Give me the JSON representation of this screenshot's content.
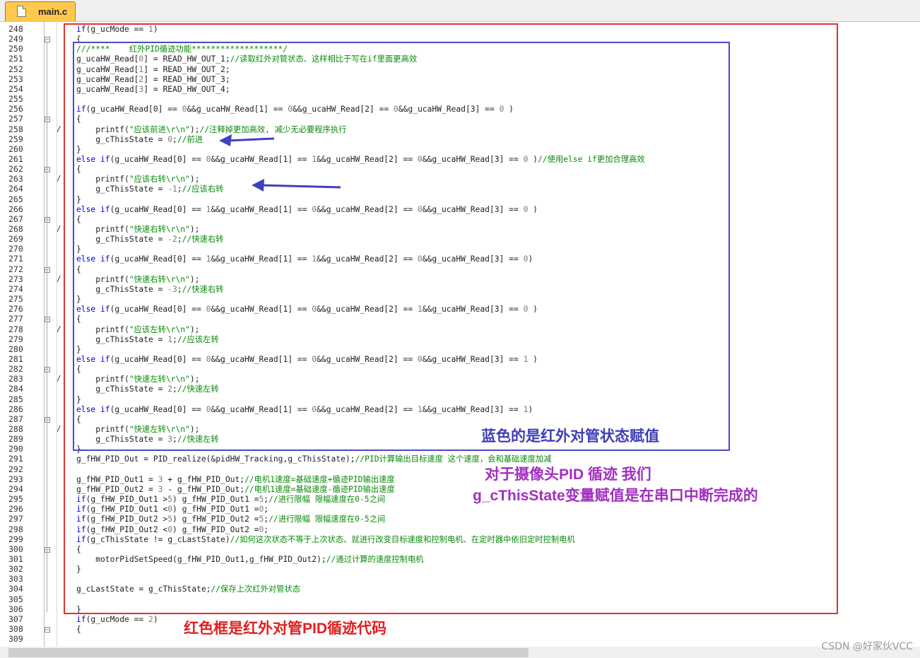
{
  "tab": {
    "filename": "main.c"
  },
  "line_numbers": [
    "248",
    "249",
    "250",
    "251",
    "252",
    "253",
    "254",
    "255",
    "256",
    "257",
    "258",
    "259",
    "260",
    "261",
    "262",
    "263",
    "264",
    "265",
    "266",
    "267",
    "268",
    "269",
    "270",
    "271",
    "272",
    "273",
    "274",
    "275",
    "276",
    "277",
    "278",
    "279",
    "280",
    "281",
    "282",
    "283",
    "284",
    "285",
    "286",
    "287",
    "288",
    "289",
    "290",
    "291",
    "292",
    "293",
    "294",
    "295",
    "296",
    "297",
    "298",
    "299",
    "300",
    "301",
    "302",
    "303",
    "304",
    "305",
    "306",
    "307",
    "308",
    "309"
  ],
  "fold_lines": [
    "249",
    "257",
    "262",
    "267",
    "272",
    "277",
    "282",
    "287",
    "300",
    "308"
  ],
  "comment_marks": [
    "258",
    "263",
    "268",
    "273",
    "278",
    "283",
    "288"
  ],
  "code_lines": [
    [
      [
        "kw",
        "if"
      ],
      [
        "t",
        "(g_ucMode == "
      ],
      [
        "num",
        "1"
      ],
      [
        "t",
        ")"
      ]
    ],
    [
      [
        "t",
        "{"
      ]
    ],
    [
      [
        "cmt",
        "///****    红外PID循迹功能*******************/"
      ]
    ],
    [
      [
        "t",
        "g_ucaHW_Read["
      ],
      [
        "num",
        "0"
      ],
      [
        "t",
        "] = READ_HW_OUT_1;"
      ],
      [
        "cmt",
        "//读取红外对管状态、这样相比于写在if里面更高效"
      ]
    ],
    [
      [
        "t",
        "g_ucaHW_Read["
      ],
      [
        "num",
        "1"
      ],
      [
        "t",
        "] = READ_HW_OUT_2;"
      ]
    ],
    [
      [
        "t",
        "g_ucaHW_Read["
      ],
      [
        "num",
        "2"
      ],
      [
        "t",
        "] = READ_HW_OUT_3;"
      ]
    ],
    [
      [
        "t",
        "g_ucaHW_Read["
      ],
      [
        "num",
        "3"
      ],
      [
        "t",
        "] = READ_HW_OUT_4;"
      ]
    ],
    [],
    [
      [
        "kw",
        "if"
      ],
      [
        "t",
        "(g_ucaHW_Read[0] == "
      ],
      [
        "num",
        "0"
      ],
      [
        "t",
        "&&g_ucaHW_Read[1] == "
      ],
      [
        "num",
        "0"
      ],
      [
        "t",
        "&&g_ucaHW_Read[2] == "
      ],
      [
        "num",
        "0"
      ],
      [
        "t",
        "&&g_ucaHW_Read[3] == "
      ],
      [
        "num",
        "0"
      ],
      [
        "t",
        " )"
      ]
    ],
    [
      [
        "t",
        "{"
      ]
    ],
    [
      [
        "t",
        "    printf("
      ],
      [
        "str",
        "\"应该前进\\r\\n\""
      ],
      [
        "t",
        ");"
      ],
      [
        "cmt",
        "//注释掉更加高效, 减少无必要程序执行"
      ]
    ],
    [
      [
        "t",
        "    g_cThisState = "
      ],
      [
        "num",
        "0"
      ],
      [
        "t",
        ";"
      ],
      [
        "cmt",
        "//前进"
      ]
    ],
    [
      [
        "t",
        "}"
      ]
    ],
    [
      [
        "kw",
        "else if"
      ],
      [
        "t",
        "(g_ucaHW_Read[0] == "
      ],
      [
        "num",
        "0"
      ],
      [
        "t",
        "&&g_ucaHW_Read[1] == "
      ],
      [
        "num",
        "1"
      ],
      [
        "t",
        "&&g_ucaHW_Read[2] == "
      ],
      [
        "num",
        "0"
      ],
      [
        "t",
        "&&g_ucaHW_Read[3] == "
      ],
      [
        "num",
        "0"
      ],
      [
        "t",
        " )"
      ],
      [
        "cmt",
        "//使用else if更加合理高效"
      ]
    ],
    [
      [
        "t",
        "{"
      ]
    ],
    [
      [
        "t",
        "    printf("
      ],
      [
        "str",
        "\"应该右转\\r\\n\""
      ],
      [
        "t",
        ");"
      ]
    ],
    [
      [
        "t",
        "    g_cThisState = "
      ],
      [
        "num",
        "-1"
      ],
      [
        "t",
        ";"
      ],
      [
        "cmt",
        "//应该右转"
      ]
    ],
    [
      [
        "t",
        "}"
      ]
    ],
    [
      [
        "kw",
        "else if"
      ],
      [
        "t",
        "(g_ucaHW_Read[0] == "
      ],
      [
        "num",
        "1"
      ],
      [
        "t",
        "&&g_ucaHW_Read[1] == "
      ],
      [
        "num",
        "0"
      ],
      [
        "t",
        "&&g_ucaHW_Read[2] == "
      ],
      [
        "num",
        "0"
      ],
      [
        "t",
        "&&g_ucaHW_Read[3] == "
      ],
      [
        "num",
        "0"
      ],
      [
        "t",
        " )"
      ]
    ],
    [
      [
        "t",
        "{"
      ]
    ],
    [
      [
        "t",
        "    printf("
      ],
      [
        "str",
        "\"快速右转\\r\\n\""
      ],
      [
        "t",
        ");"
      ]
    ],
    [
      [
        "t",
        "    g_cThisState = "
      ],
      [
        "num",
        "-2"
      ],
      [
        "t",
        ";"
      ],
      [
        "cmt",
        "//快速右转"
      ]
    ],
    [
      [
        "t",
        "}"
      ]
    ],
    [
      [
        "kw",
        "else if"
      ],
      [
        "t",
        "(g_ucaHW_Read[0] == "
      ],
      [
        "num",
        "1"
      ],
      [
        "t",
        "&&g_ucaHW_Read[1] == "
      ],
      [
        "num",
        "1"
      ],
      [
        "t",
        "&&g_ucaHW_Read[2] == "
      ],
      [
        "num",
        "0"
      ],
      [
        "t",
        "&&g_ucaHW_Read[3] == "
      ],
      [
        "num",
        "0"
      ],
      [
        "t",
        ")"
      ]
    ],
    [
      [
        "t",
        "{"
      ]
    ],
    [
      [
        "t",
        "    printf("
      ],
      [
        "str",
        "\"快速右转\\r\\n\""
      ],
      [
        "t",
        ");"
      ]
    ],
    [
      [
        "t",
        "    g_cThisState = "
      ],
      [
        "num",
        "-3"
      ],
      [
        "t",
        ";"
      ],
      [
        "cmt",
        "//快速右转"
      ]
    ],
    [
      [
        "t",
        "}"
      ]
    ],
    [
      [
        "kw",
        "else if"
      ],
      [
        "t",
        "(g_ucaHW_Read[0] == "
      ],
      [
        "num",
        "0"
      ],
      [
        "t",
        "&&g_ucaHW_Read[1] == "
      ],
      [
        "num",
        "0"
      ],
      [
        "t",
        "&&g_ucaHW_Read[2] == "
      ],
      [
        "num",
        "1"
      ],
      [
        "t",
        "&&g_ucaHW_Read[3] == "
      ],
      [
        "num",
        "0"
      ],
      [
        "t",
        " )"
      ]
    ],
    [
      [
        "t",
        "{"
      ]
    ],
    [
      [
        "t",
        "    printf("
      ],
      [
        "str",
        "\"应该左转\\r\\n\""
      ],
      [
        "t",
        ");"
      ]
    ],
    [
      [
        "t",
        "    g_cThisState = "
      ],
      [
        "num",
        "1"
      ],
      [
        "t",
        ";"
      ],
      [
        "cmt",
        "//应该左转"
      ]
    ],
    [
      [
        "t",
        "}"
      ]
    ],
    [
      [
        "kw",
        "else if"
      ],
      [
        "t",
        "(g_ucaHW_Read[0] == "
      ],
      [
        "num",
        "0"
      ],
      [
        "t",
        "&&g_ucaHW_Read[1] == "
      ],
      [
        "num",
        "0"
      ],
      [
        "t",
        "&&g_ucaHW_Read[2] == "
      ],
      [
        "num",
        "0"
      ],
      [
        "t",
        "&&g_ucaHW_Read[3] == "
      ],
      [
        "num",
        "1"
      ],
      [
        "t",
        " )"
      ]
    ],
    [
      [
        "t",
        "{"
      ]
    ],
    [
      [
        "t",
        "    printf("
      ],
      [
        "str",
        "\"快速左转\\r\\n\""
      ],
      [
        "t",
        ");"
      ]
    ],
    [
      [
        "t",
        "    g_cThisState = "
      ],
      [
        "num",
        "2"
      ],
      [
        "t",
        ";"
      ],
      [
        "cmt",
        "//快速左转"
      ]
    ],
    [
      [
        "t",
        "}"
      ]
    ],
    [
      [
        "kw",
        "else if"
      ],
      [
        "t",
        "(g_ucaHW_Read[0] == "
      ],
      [
        "num",
        "0"
      ],
      [
        "t",
        "&&g_ucaHW_Read[1] == "
      ],
      [
        "num",
        "0"
      ],
      [
        "t",
        "&&g_ucaHW_Read[2] == "
      ],
      [
        "num",
        "1"
      ],
      [
        "t",
        "&&g_ucaHW_Read[3] == "
      ],
      [
        "num",
        "1"
      ],
      [
        "t",
        ")"
      ]
    ],
    [
      [
        "t",
        "{"
      ]
    ],
    [
      [
        "t",
        "    printf("
      ],
      [
        "str",
        "\"快速左转\\r\\n\""
      ],
      [
        "t",
        ");"
      ]
    ],
    [
      [
        "t",
        "    g_cThisState = "
      ],
      [
        "num",
        "3"
      ],
      [
        "t",
        ";"
      ],
      [
        "cmt",
        "//快速左转"
      ]
    ],
    [
      [
        "t",
        "}"
      ]
    ],
    [
      [
        "t",
        "g_fHW_PID_Out = PID_realize(&pidHW_Tracking,g_cThisState);"
      ],
      [
        "cmt",
        "//PID计算输出目标速度 这个速度，会和基础速度加减"
      ]
    ],
    [],
    [
      [
        "t",
        "g_fHW_PID_Out1 = "
      ],
      [
        "num",
        "3"
      ],
      [
        "t",
        " + g_fHW_PID_Out;"
      ],
      [
        "cmt",
        "//电机1速度=基础速度+循迹PID输出速度"
      ]
    ],
    [
      [
        "t",
        "g_fHW_PID_Out2 = "
      ],
      [
        "num",
        "3"
      ],
      [
        "t",
        " - g_fHW_PID_Out;"
      ],
      [
        "cmt",
        "//电机1速度=基础速度-循迹PID输出速度"
      ]
    ],
    [
      [
        "kw",
        "if"
      ],
      [
        "t",
        "(g_fHW_PID_Out1 >"
      ],
      [
        "num",
        "5"
      ],
      [
        "t",
        ") g_fHW_PID_Out1 ="
      ],
      [
        "num",
        "5"
      ],
      [
        "t",
        ";"
      ],
      [
        "cmt",
        "//进行限幅 限幅速度在0-5之间"
      ]
    ],
    [
      [
        "kw",
        "if"
      ],
      [
        "t",
        "(g_fHW_PID_Out1 <"
      ],
      [
        "num",
        "0"
      ],
      [
        "t",
        ") g_fHW_PID_Out1 ="
      ],
      [
        "num",
        "0"
      ],
      [
        "t",
        ";"
      ]
    ],
    [
      [
        "kw",
        "if"
      ],
      [
        "t",
        "(g_fHW_PID_Out2 >"
      ],
      [
        "num",
        "5"
      ],
      [
        "t",
        ") g_fHW_PID_Out2 ="
      ],
      [
        "num",
        "5"
      ],
      [
        "t",
        ";"
      ],
      [
        "cmt",
        "//进行限幅 限幅速度在0-5之间"
      ]
    ],
    [
      [
        "kw",
        "if"
      ],
      [
        "t",
        "(g_fHW_PID_Out2 <"
      ],
      [
        "num",
        "0"
      ],
      [
        "t",
        ") g_fHW_PID_Out2 ="
      ],
      [
        "num",
        "0"
      ],
      [
        "t",
        ";"
      ]
    ],
    [
      [
        "kw",
        "if"
      ],
      [
        "t",
        "(g_cThisState != g_cLastState)"
      ],
      [
        "cmt",
        "//如何这次状态不等于上次状态、就进行改变目标速度和控制电机、在定时器中依旧定时控制电机"
      ]
    ],
    [
      [
        "t",
        "{"
      ]
    ],
    [
      [
        "t",
        "    motorPidSetSpeed(g_fHW_PID_Out1,g_fHW_PID_Out2);"
      ],
      [
        "cmt",
        "//通过计算的速度控制电机"
      ]
    ],
    [
      [
        "t",
        "}"
      ]
    ],
    [],
    [
      [
        "t",
        "g_cLastState = g_cThisState;"
      ],
      [
        "cmt",
        "//保存上次红外对管状态"
      ]
    ],
    [],
    [
      [
        "t",
        "}"
      ]
    ],
    [
      [
        "kw",
        "if"
      ],
      [
        "t",
        "(g_ucMode == "
      ],
      [
        "num",
        "2"
      ],
      [
        "t",
        ")"
      ]
    ],
    [
      [
        "t",
        "{"
      ]
    ],
    []
  ],
  "annotations": {
    "blue_note": "蓝色的是红外对管状态赋值",
    "purple_note_1": "对于摄像头PID 循迹 我们",
    "purple_note_2": "g_cThisState变量赋值是在串口中断完成的",
    "red_note": "红色框是红外对管PID循迹代码"
  },
  "colors": {
    "red_frame": "#e53030",
    "blue_frame": "#4a4bc9",
    "blue_text": "#3f3fb8",
    "purple_text": "#a22fc0",
    "red_text": "#e02020",
    "arrow": "#4040c0"
  },
  "watermark": "CSDN @好家伙VCC"
}
